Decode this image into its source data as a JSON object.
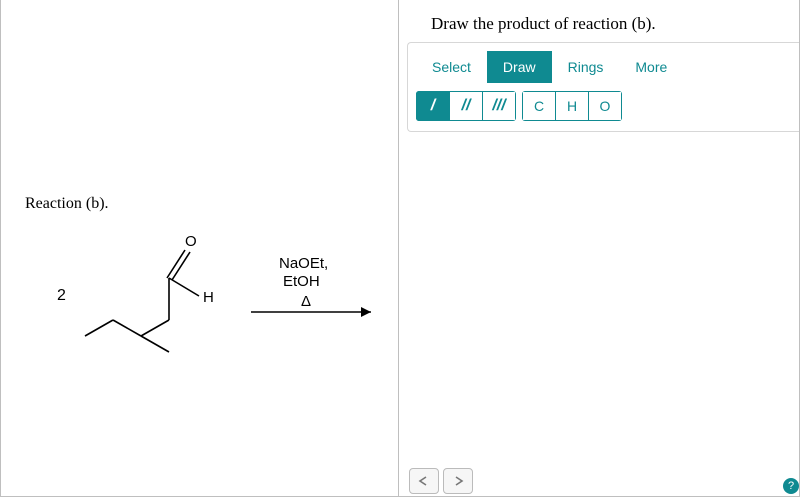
{
  "left": {
    "reaction_label": "Reaction (b).",
    "coefficient": "2",
    "atom_O": "O",
    "atom_H": "H",
    "reagent_line1": "NaOEt,",
    "reagent_line2": "EtOH",
    "reagent_delta": "Δ"
  },
  "right": {
    "prompt": "Draw the product of reaction (b).",
    "tabs": {
      "select": "Select",
      "draw": "Draw",
      "rings": "Rings",
      "more": "More"
    },
    "bond_single": "/",
    "bond_double": "//",
    "bond_triple": "///",
    "atom_C": "C",
    "atom_H": "H",
    "atom_O": "O"
  }
}
